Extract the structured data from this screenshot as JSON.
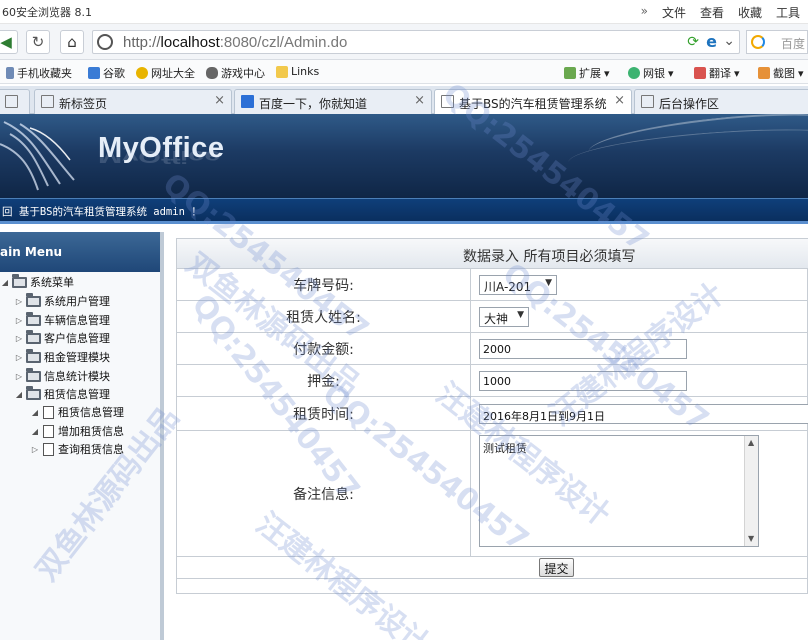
{
  "browser": {
    "window_title": "60安全浏览器 8.1",
    "menus": [
      "»",
      "文件",
      "查看",
      "收藏",
      "工具"
    ],
    "url_prefix": "http://",
    "url_host": "localhost",
    "url_rest": ":8080/czl/Admin.do",
    "search_placeholder": "百度",
    "favorites": [
      "手机收藏夹",
      "谷歌",
      "网址大全",
      "游戏中心",
      "Links"
    ],
    "toolbar_right": [
      "扩展",
      "网银",
      "翻译",
      "截图"
    ],
    "tabs": [
      {
        "label": "新标签页",
        "active": false,
        "close": "×"
      },
      {
        "label": "百度一下，你就知道",
        "active": false,
        "close": "×"
      },
      {
        "label": "基于BS的汽车租赁管理系统",
        "active": true,
        "close": "×"
      },
      {
        "label": "后台操作区",
        "active": false,
        "close": ""
      }
    ]
  },
  "app": {
    "logo": "MyOffice",
    "welcome": "回 基于BS的汽车租赁管理系统 admin ！"
  },
  "sidebar": {
    "title": "ain Menu",
    "root": "系统菜单",
    "groups": [
      "系统用户管理",
      "车辆信息管理",
      "客户信息管理",
      "租金管理模块",
      "信息统计模块",
      "租赁信息管理"
    ],
    "children": [
      "租赁信息管理",
      "增加租赁信息",
      "查询租赁信息"
    ]
  },
  "form": {
    "heading": "数据录入  所有项目必须填写",
    "plate_label": "车牌号码:",
    "plate_value": "川A-201",
    "renter_label": "租赁人姓名:",
    "renter_value": "大神",
    "amount_label": "付款金额:",
    "amount_value": "2000",
    "deposit_label": "押金:",
    "deposit_value": "1000",
    "period_label": "租赁时间:",
    "period_value": "2016年8月1日到9月1日",
    "remark_label": "备注信息:",
    "remark_value": "测试租赁",
    "submit_label": "提交"
  },
  "watermarks": [
    "QQ:254540457",
    "汪建林程序设计",
    "双鱼林源码出品"
  ],
  "colors": {
    "header_dark": "#0f2646",
    "header_light": "#2f5a88",
    "welcome_bar": "#0a2f5f",
    "sidebar_head": "#1f4778",
    "watermark": "#6e8cd2"
  }
}
